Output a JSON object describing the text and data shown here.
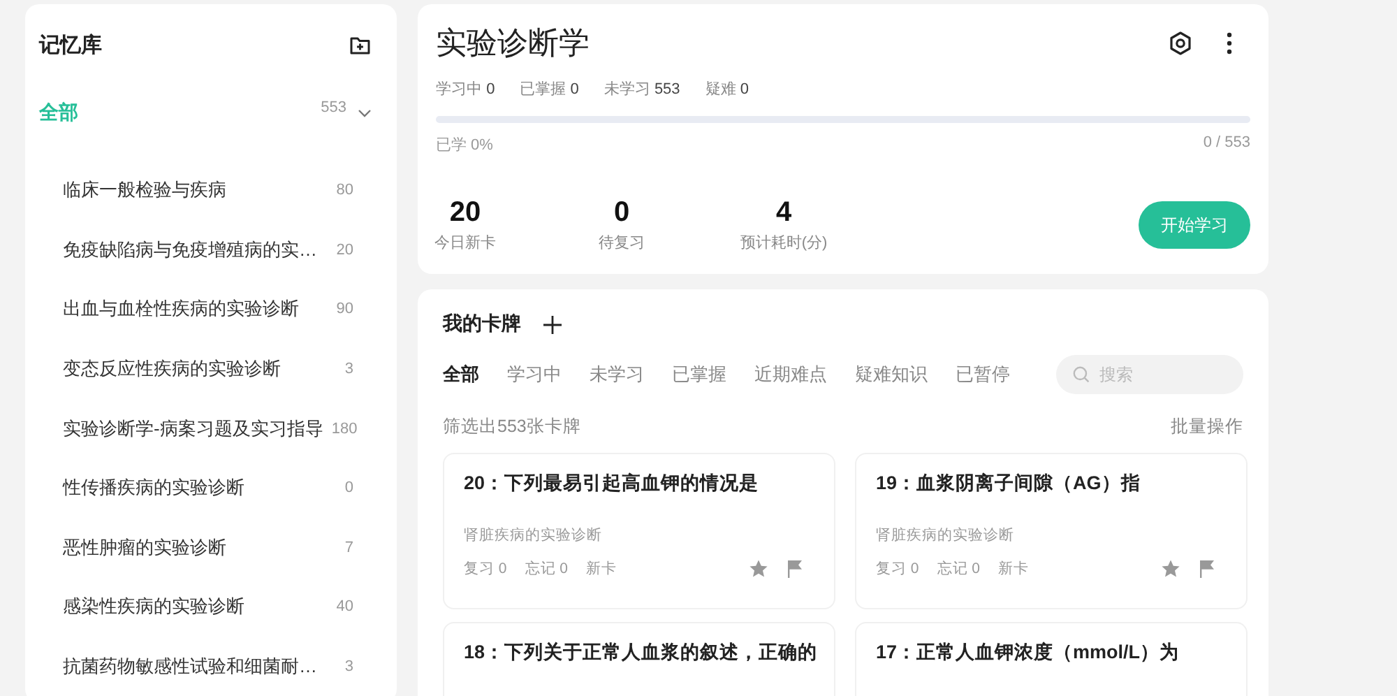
{
  "sidebar": {
    "title": "记忆库",
    "root": {
      "label": "全部",
      "count": "553",
      "expanded": true,
      "selected": true,
      "children": [
        {
          "label": "临床一般检验与疾病",
          "count": "80",
          "selected": false
        },
        {
          "label": "免疫缺陷病与免疫增殖病的实…",
          "count": "20",
          "selected": false
        },
        {
          "label": "出血与血栓性疾病的实验诊断",
          "count": "90",
          "selected": false
        },
        {
          "label": "变态反应性疾病的实验诊断",
          "count": "3",
          "selected": false
        },
        {
          "label": "实验诊断学-病案习题及实习指导",
          "count": "180",
          "selected": false
        },
        {
          "label": "性传播疾病的实验诊断",
          "count": "0",
          "selected": false
        },
        {
          "label": "恶性肿瘤的实验诊断",
          "count": "7",
          "selected": false
        },
        {
          "label": "感染性疾病的实验诊断",
          "count": "40",
          "selected": false
        },
        {
          "label": "抗菌药物敏感性试验和细菌耐…",
          "count": "3",
          "selected": false
        }
      ]
    }
  },
  "deck": {
    "title": "实验诊断学",
    "stats": [
      {
        "label": "学习中",
        "value": "0"
      },
      {
        "label": "已掌握",
        "value": "0"
      },
      {
        "label": "未学习",
        "value": "553"
      },
      {
        "label": "疑难",
        "value": "0"
      }
    ],
    "progress": {
      "level": 0,
      "label": "已学 0%",
      "reading": "0 / 553"
    },
    "summary": [
      {
        "value": "20",
        "label": "今日新卡"
      },
      {
        "value": "0",
        "label": "待复习"
      },
      {
        "value": "4",
        "label": "预计耗时(分)"
      }
    ],
    "start_button": "开始学习"
  },
  "cards_panel": {
    "title": "我的卡牌",
    "tabs": [
      {
        "label": "全部",
        "selected": true
      },
      {
        "label": "学习中",
        "selected": false
      },
      {
        "label": "未学习",
        "selected": false
      },
      {
        "label": "已掌握",
        "selected": false
      },
      {
        "label": "近期难点",
        "selected": false
      },
      {
        "label": "疑难知识",
        "selected": false
      },
      {
        "label": "已暂停",
        "selected": false
      }
    ],
    "search": {
      "placeholder": "搜索"
    },
    "filter_text": "筛选出553张卡牌",
    "batch_button": "批量操作",
    "cards": [
      {
        "title": "20：下列最易引起高血钾的情况是",
        "category": "肾脏疾病的实验诊断",
        "review": "复习 0",
        "forget": "忘记 0",
        "status": "新卡",
        "starred": false,
        "flagged": false
      },
      {
        "title": "19：血浆阴离子间隙（AG）指",
        "category": "肾脏疾病的实验诊断",
        "review": "复习 0",
        "forget": "忘记 0",
        "status": "新卡",
        "starred": false,
        "flagged": false
      },
      {
        "title": "18：下列关于正常人血浆的叙述，正确的"
      },
      {
        "title": "17：正常人血钾浓度（mmol/L）为"
      }
    ]
  }
}
